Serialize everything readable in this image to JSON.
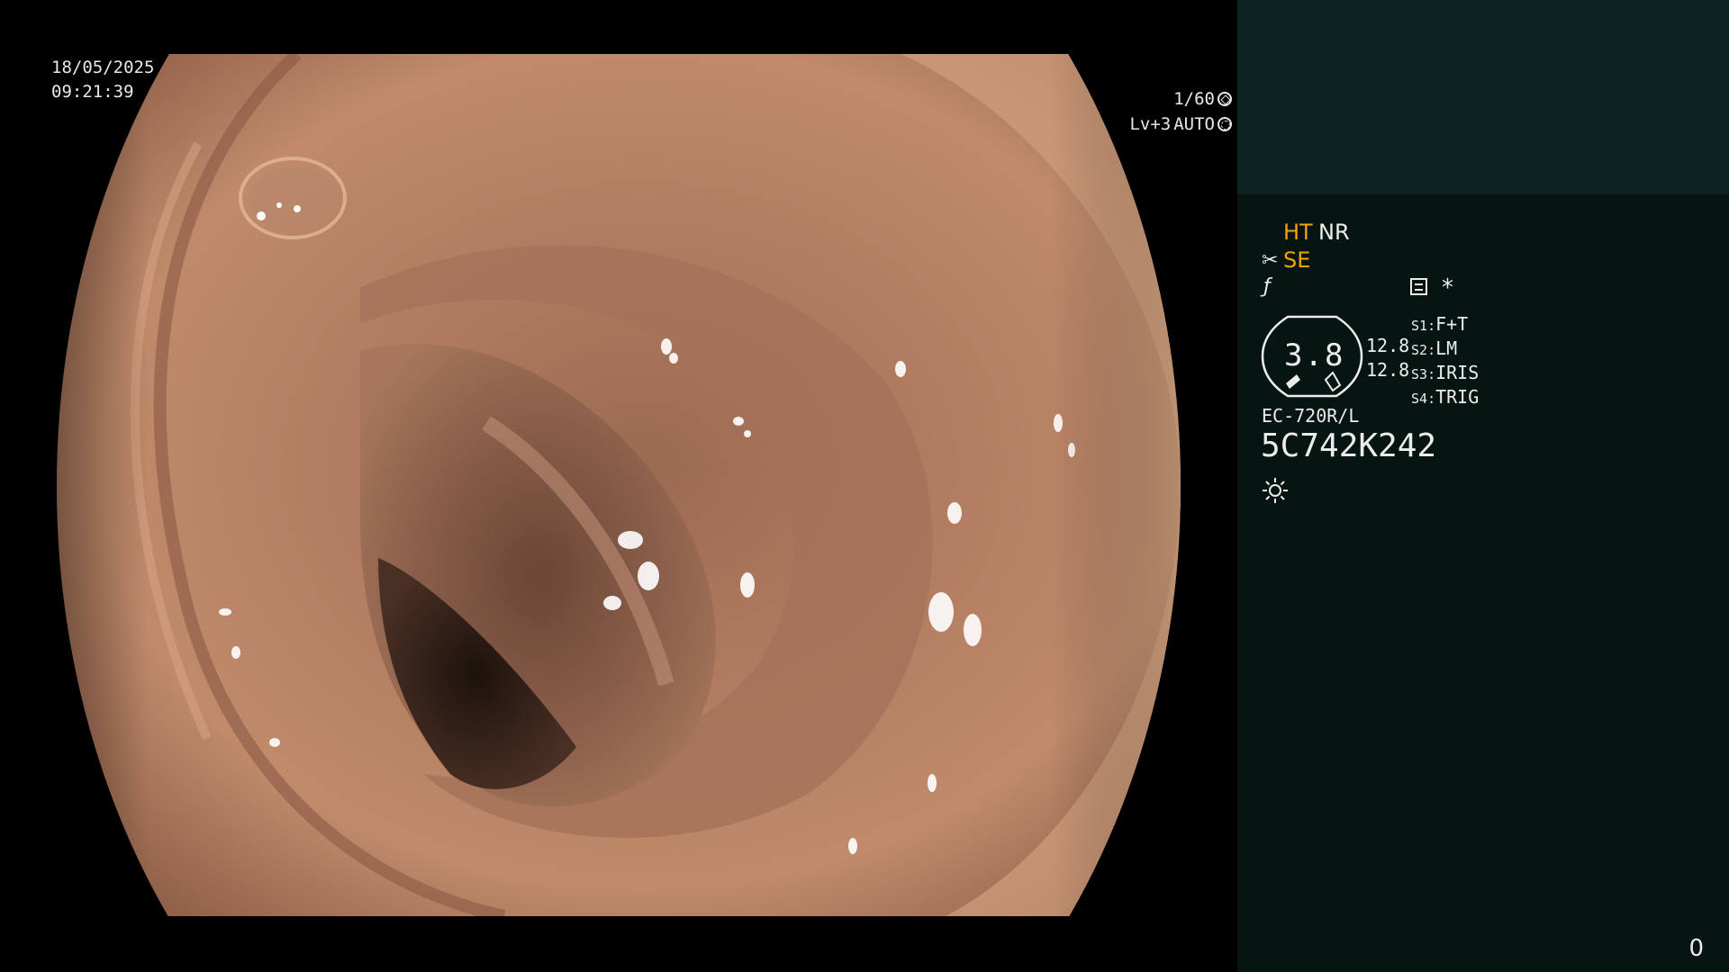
{
  "overlay": {
    "date": "18/05/2025",
    "time": "09:21:39",
    "shutter": "1/60",
    "level": "Lv+3",
    "mode": "AUTO"
  },
  "panel": {
    "image_modes": {
      "ht": "HT",
      "nr": "NR",
      "se": "SE"
    },
    "asterisk": "*",
    "zoom_value": "3.8",
    "side_values": [
      "12.8",
      "12.8"
    ],
    "switches": [
      {
        "key": "S1",
        "value": "F+T"
      },
      {
        "key": "S2",
        "value": "LM"
      },
      {
        "key": "S3",
        "value": "IRIS"
      },
      {
        "key": "S4",
        "value": "TRIG"
      }
    ],
    "scope_model": "EC-720R/L",
    "serial_number": "5C742K242",
    "counter": "0"
  },
  "colors": {
    "accent_orange": "#f0a400",
    "panel_dark": "#061412",
    "panel_top": "#0d2322",
    "text": "#ececec"
  },
  "icons": [
    "aperture-icon",
    "settings-icon",
    "scissor-icon",
    "f-slash-icon",
    "report-icon",
    "light-icon"
  ]
}
